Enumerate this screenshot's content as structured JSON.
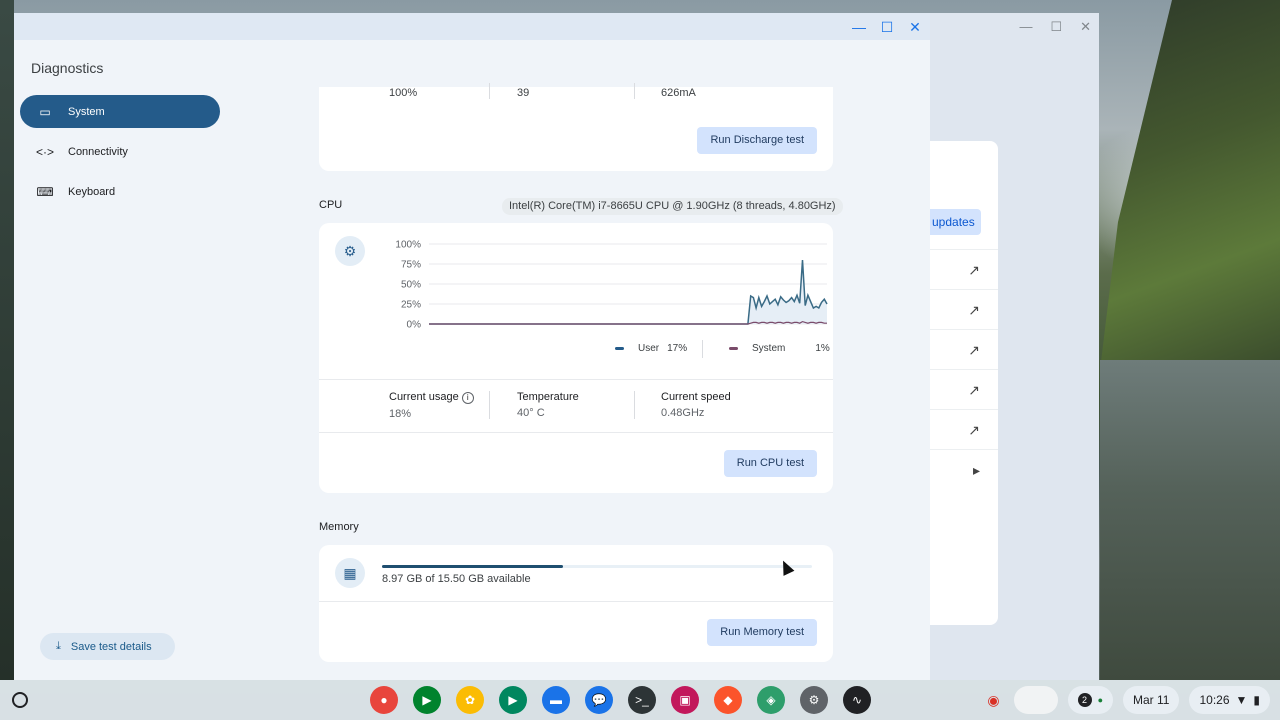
{
  "window": {
    "app_title": "Diagnostics",
    "minimize": "—",
    "maximize": "☐",
    "close": "✕"
  },
  "nav": {
    "items": [
      {
        "label": "System",
        "icon": "laptop-icon",
        "glyph": "💻",
        "active": true
      },
      {
        "label": "Connectivity",
        "icon": "connectivity-icon",
        "glyph": "<·>"
      },
      {
        "label": "Keyboard",
        "icon": "keyboard-icon",
        "glyph": "⌨"
      }
    ],
    "save_label": "Save test details"
  },
  "battery": {
    "stats": [
      "100%",
      "39",
      "626mA"
    ],
    "button": "Run Discharge test"
  },
  "cpu": {
    "section_label": "CPU",
    "model": "Intel(R) Core(TM) i7-8665U CPU @ 1.90GHz (8 threads, 4.80GHz)",
    "legend": [
      {
        "name": "User",
        "value": "17%",
        "color": "#245b8a"
      },
      {
        "name": "System",
        "value": "1%",
        "color": "#7a4b6a"
      }
    ],
    "stats": {
      "usage_label": "Current usage",
      "usage_value": "18%",
      "temp_label": "Temperature",
      "temp_value": "40° C",
      "speed_label": "Current speed",
      "speed_value": "0.48GHz"
    },
    "button": "Run CPU test"
  },
  "chart_data": {
    "type": "area",
    "yticks": [
      "100%",
      "75%",
      "50%",
      "25%",
      "0%"
    ],
    "ylim": [
      0,
      100
    ],
    "series": [
      {
        "name": "User",
        "values": [
          0,
          0,
          0,
          0,
          0,
          0,
          0,
          0,
          0,
          0,
          0,
          0,
          0,
          0,
          0,
          0,
          0,
          0,
          0,
          0,
          0,
          0,
          0,
          0,
          0,
          0,
          0,
          0,
          0,
          0,
          0,
          0,
          0,
          0,
          0,
          0,
          0,
          0,
          0,
          0,
          0,
          0,
          0,
          0,
          0,
          0,
          0,
          0,
          0,
          0,
          0,
          0,
          0,
          0,
          0,
          0,
          0,
          0,
          0,
          0,
          0,
          0,
          0,
          0,
          0,
          0,
          0,
          0,
          0,
          0,
          0,
          0,
          0,
          0,
          0,
          0,
          0,
          0,
          0,
          0,
          0,
          0,
          0,
          0,
          0,
          0,
          0,
          0,
          0,
          0,
          0,
          0,
          0,
          0,
          0,
          0,
          0,
          0,
          0,
          0,
          0,
          0,
          0,
          0,
          0,
          0,
          0,
          0,
          0,
          0,
          0,
          0,
          0,
          0,
          0,
          0,
          0,
          0,
          35,
          33,
          20,
          33,
          22,
          28,
          35,
          25,
          28,
          31,
          24,
          34,
          30,
          27,
          29,
          33,
          28,
          36,
          26,
          80,
          23,
          36,
          28,
          20,
          22,
          20,
          27,
          31,
          25
        ]
      },
      {
        "name": "System",
        "values": [
          0,
          0,
          0,
          0,
          0,
          0,
          0,
          0,
          0,
          0,
          0,
          0,
          0,
          0,
          0,
          0,
          0,
          0,
          0,
          0,
          0,
          0,
          0,
          0,
          0,
          0,
          0,
          0,
          0,
          0,
          0,
          0,
          0,
          0,
          0,
          0,
          0,
          0,
          0,
          0,
          0,
          0,
          0,
          0,
          0,
          0,
          0,
          0,
          0,
          0,
          0,
          0,
          0,
          0,
          0,
          0,
          0,
          0,
          0,
          0,
          0,
          0,
          0,
          0,
          0,
          0,
          0,
          0,
          0,
          0,
          0,
          0,
          0,
          0,
          0,
          0,
          0,
          0,
          0,
          0,
          0,
          0,
          0,
          0,
          0,
          0,
          0,
          0,
          0,
          0,
          0,
          0,
          0,
          0,
          0,
          0,
          0,
          0,
          0,
          0,
          0,
          0,
          0,
          0,
          0,
          0,
          0,
          0,
          0,
          0,
          0,
          0,
          0,
          0,
          0,
          0,
          0,
          0,
          1,
          2,
          2,
          1,
          2,
          2,
          1,
          2,
          2,
          1,
          2,
          2,
          1,
          2,
          2,
          1,
          2,
          2,
          1,
          3,
          2,
          1,
          2,
          2,
          1,
          2,
          2,
          1,
          1
        ]
      }
    ]
  },
  "memory": {
    "section_label": "Memory",
    "available_text": "8.97 GB of 15.50 GB available",
    "used_fraction": 0.42,
    "button": "Run Memory test"
  },
  "bg_window": {
    "updates_label": "updates"
  },
  "shelf": {
    "apps": [
      {
        "name": "chrome-icon",
        "color": "#e8453c",
        "glyph": "●"
      },
      {
        "name": "meet-icon",
        "color": "#00832d",
        "glyph": "▶"
      },
      {
        "name": "photos-icon",
        "color": "#fbbc04",
        "glyph": "✿"
      },
      {
        "name": "play-store-icon",
        "color": "#01875f",
        "glyph": "▶"
      },
      {
        "name": "files-icon",
        "color": "#1a73e8",
        "glyph": "▬"
      },
      {
        "name": "messages-icon",
        "color": "#1a73e8",
        "glyph": "💬"
      },
      {
        "name": "terminal-icon",
        "color": "#2d3436",
        "glyph": ">_"
      },
      {
        "name": "app-icon-pink",
        "color": "#c2185b",
        "glyph": "▣"
      },
      {
        "name": "brave-icon",
        "color": "#fb542b",
        "glyph": "◆"
      },
      {
        "name": "app-icon-green",
        "color": "#2e9e6b",
        "glyph": "◈"
      },
      {
        "name": "settings-icon",
        "color": "#5f6368",
        "glyph": "⚙"
      },
      {
        "name": "diagnostics-icon",
        "color": "#202124",
        "glyph": "∿"
      }
    ],
    "notification_count": "2",
    "date": "Mar 11",
    "time": "10:26"
  }
}
